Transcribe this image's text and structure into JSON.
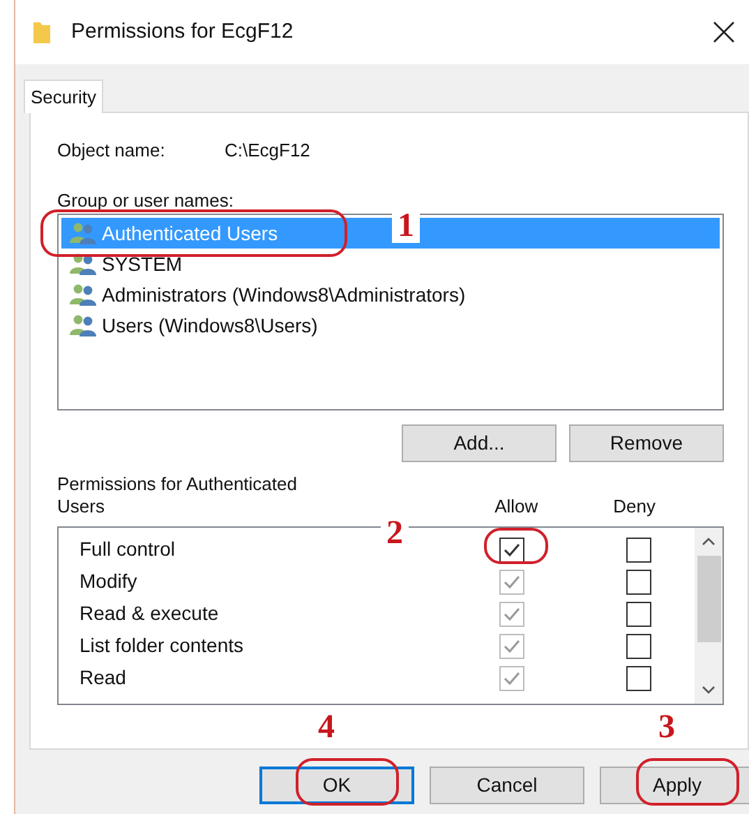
{
  "window": {
    "title": "Permissions for EcgF12"
  },
  "tabs": [
    {
      "label": "Security",
      "selected": true
    }
  ],
  "object_name": {
    "label": "Object name:",
    "value": "C:\\EcgF12"
  },
  "group_label": "Group or user names:",
  "users": [
    {
      "name": "Authenticated Users",
      "selected": true,
      "callout": "1"
    },
    {
      "name": "SYSTEM",
      "selected": false
    },
    {
      "name": "Administrators (Windows8\\Administrators)",
      "selected": false
    },
    {
      "name": "Users (Windows8\\Users)",
      "selected": false
    }
  ],
  "user_buttons": [
    {
      "label": "Add..."
    },
    {
      "label": "Remove"
    }
  ],
  "permissions_label": "Permissions for Authenticated Users",
  "columns": [
    "Allow",
    "Deny"
  ],
  "permissions": [
    {
      "name": "Full control",
      "allow": true,
      "allow_disabled": false,
      "deny": false,
      "callout": "2"
    },
    {
      "name": "Modify",
      "allow": true,
      "allow_disabled": true,
      "deny": false
    },
    {
      "name": "Read & execute",
      "allow": true,
      "allow_disabled": true,
      "deny": false
    },
    {
      "name": "List folder contents",
      "allow": true,
      "allow_disabled": true,
      "deny": false
    },
    {
      "name": "Read",
      "allow": true,
      "allow_disabled": true,
      "deny": false
    }
  ],
  "buttons": [
    {
      "label": "OK",
      "default": true,
      "callout": "4"
    },
    {
      "label": "Cancel",
      "default": false
    },
    {
      "label": "Apply",
      "default": false,
      "callout": "3"
    }
  ]
}
